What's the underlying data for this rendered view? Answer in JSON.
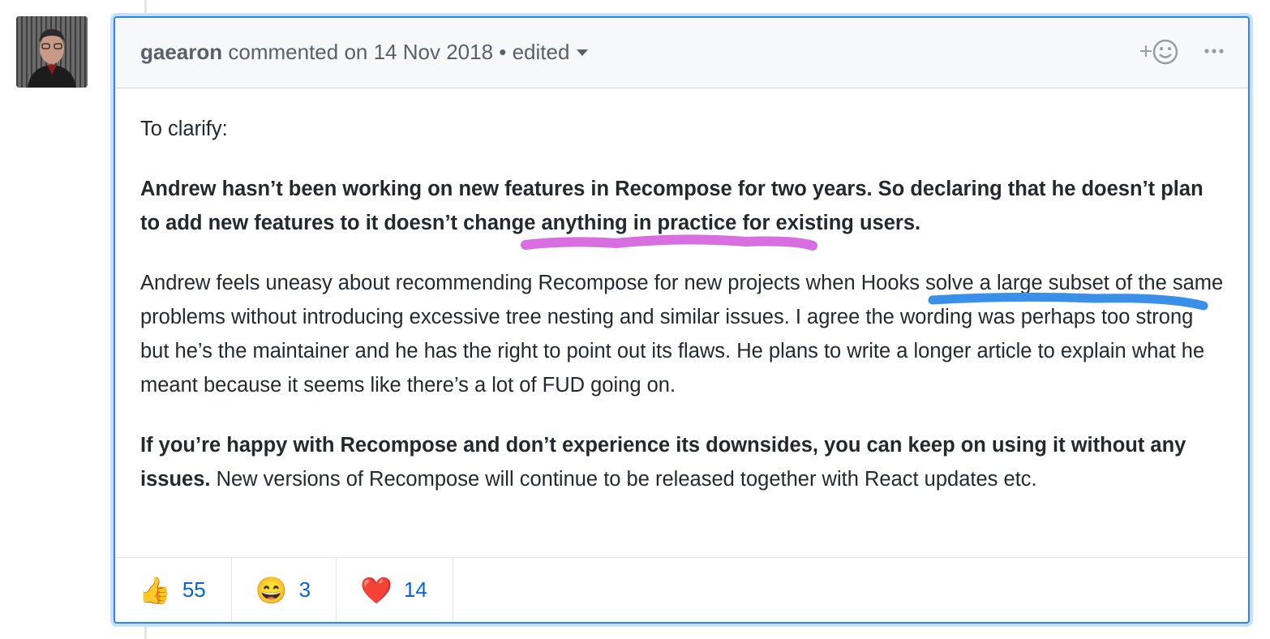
{
  "comment": {
    "author": "gaearon",
    "meta": "commented on 14 Nov 2018 • edited",
    "body": {
      "p1": "To clarify:",
      "p2": "Andrew hasn’t been working on new features in Recompose for two years. So declaring that he doesn’t plan to add new features to it doesn’t change anything in practice for existing users.",
      "p3": "Andrew feels uneasy about recommending Recompose for new projects when Hooks solve a large subset of the same problems without introducing excessive tree nesting and similar issues. I agree the wording was perhaps too strong but he’s the maintainer and he has the right to point out its flaws. He plans to write a longer article to explain what he meant because it seems like there’s a lot of FUD going on.",
      "p4_bold": "If you’re happy with Recompose and don’t experience its downsides, you can keep on using it without any issues.",
      "p4_rest": " New versions of Recompose will continue to be released together with React updates etc."
    },
    "reactions": [
      {
        "emoji": "👍",
        "icon": "thumbs-up-icon",
        "count": "55"
      },
      {
        "emoji": "😄",
        "icon": "smile-icon",
        "count": "3"
      },
      {
        "emoji": "❤️",
        "icon": "heart-icon",
        "count": "14"
      }
    ]
  },
  "colors": {
    "highlight_border": "#2f81f7",
    "annotation_pink": "#d96ee0",
    "annotation_blue": "#3a8fe8",
    "link": "#0366d6"
  }
}
